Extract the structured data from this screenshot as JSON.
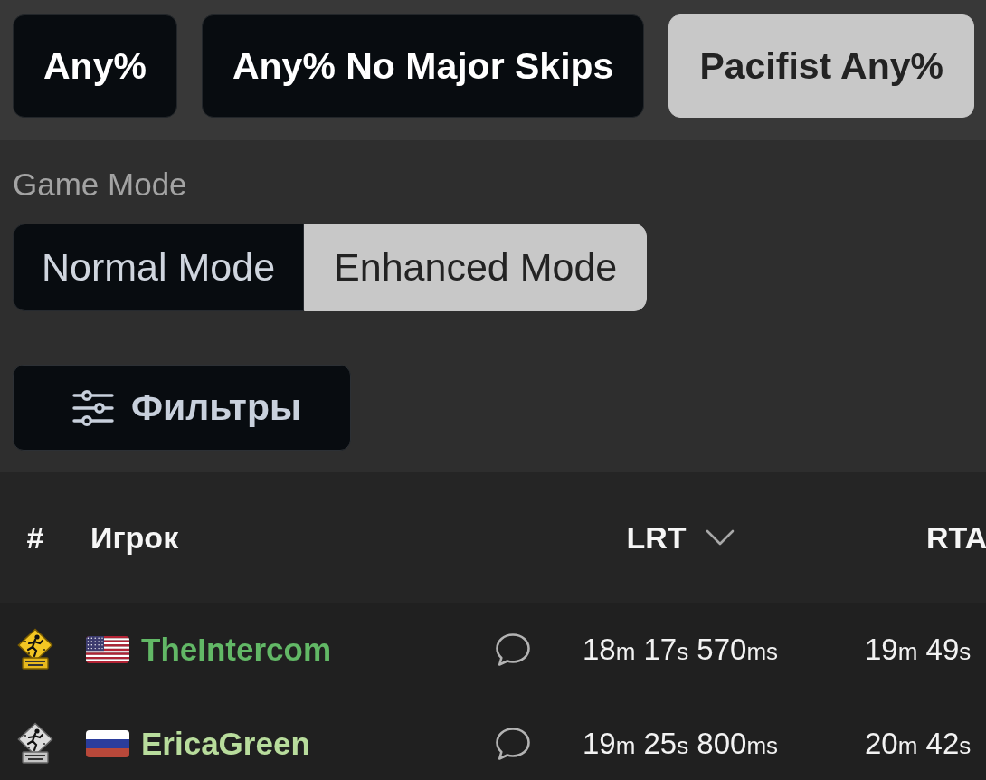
{
  "categories": [
    {
      "label": "Any%",
      "selected": false
    },
    {
      "label": "Any% No Major Skips",
      "selected": false
    },
    {
      "label": "Pacifist Any%",
      "selected": true
    }
  ],
  "game_mode": {
    "label": "Game Mode",
    "options": [
      {
        "label": "Normal Mode",
        "selected": false
      },
      {
        "label": "Enhanced Mode",
        "selected": true
      }
    ]
  },
  "filters_button": {
    "label": "Фильтры"
  },
  "table": {
    "columns": [
      {
        "label": "#",
        "sorted": false
      },
      {
        "label": "Игрок",
        "sorted": false
      },
      {
        "label": "LRT",
        "sorted": true
      },
      {
        "label": "RTA",
        "sorted": false
      }
    ],
    "rows": [
      {
        "kind": "gold",
        "flag": {
          "kind": "us"
        },
        "player": "TheIntercom",
        "color": "#62b866",
        "comment": true,
        "lrt": [
          {
            "number": "18",
            "unit": "m"
          },
          {
            "number": "17",
            "unit": "s"
          },
          {
            "number": "570",
            "unit": "ms"
          }
        ],
        "rta": [
          {
            "number": "19",
            "unit": "m"
          },
          {
            "number": "49",
            "unit": "s"
          }
        ]
      },
      {
        "kind": "silver",
        "flag": {
          "kind": "ru"
        },
        "player": "EricaGreen",
        "color": "#b8dc9c",
        "comment": true,
        "lrt": [
          {
            "number": "19",
            "unit": "m"
          },
          {
            "number": "25",
            "unit": "s"
          },
          {
            "number": "800",
            "unit": "ms"
          }
        ],
        "rta": [
          {
            "number": "20",
            "unit": "m"
          },
          {
            "number": "42",
            "unit": "s"
          }
        ]
      }
    ]
  }
}
